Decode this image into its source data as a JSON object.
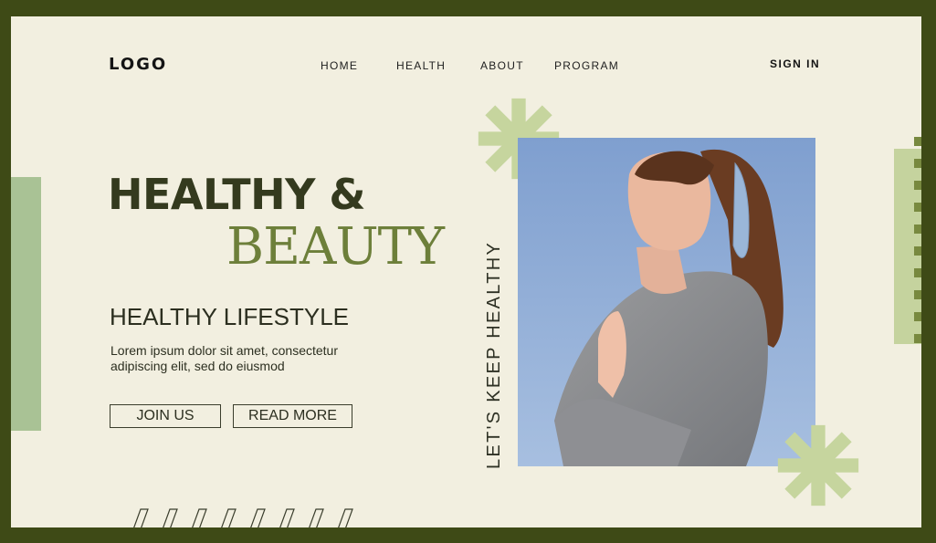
{
  "colors": {
    "frame": "#3e4a16",
    "page": "#f2efe0",
    "accent_green": "#6d7f3a",
    "soft_green": "#a9c295",
    "pale_green": "#c5d39e",
    "dark_text": "#343a1e"
  },
  "header": {
    "logo": "LOGO",
    "nav": [
      "HOME",
      "HEALTH",
      "ABOUT",
      "PROGRAM"
    ],
    "signin": "SIGN IN"
  },
  "hero": {
    "title_line1": "HEALTHY &",
    "title_line2": "BEAUTY",
    "subtitle": "HEALTHY LIFESTYLE",
    "description": "Lorem ipsum dolor sit amet, consectetur adipiscing elit, sed do eiusmod",
    "buttons": {
      "join": "JOIN US",
      "read_more": "READ MORE"
    },
    "vertical_tagline": "LET'S KEEP HEALTHY"
  },
  "icons": [
    "asterisk-icon",
    "slash-stripes",
    "photo-woman-meditating"
  ]
}
